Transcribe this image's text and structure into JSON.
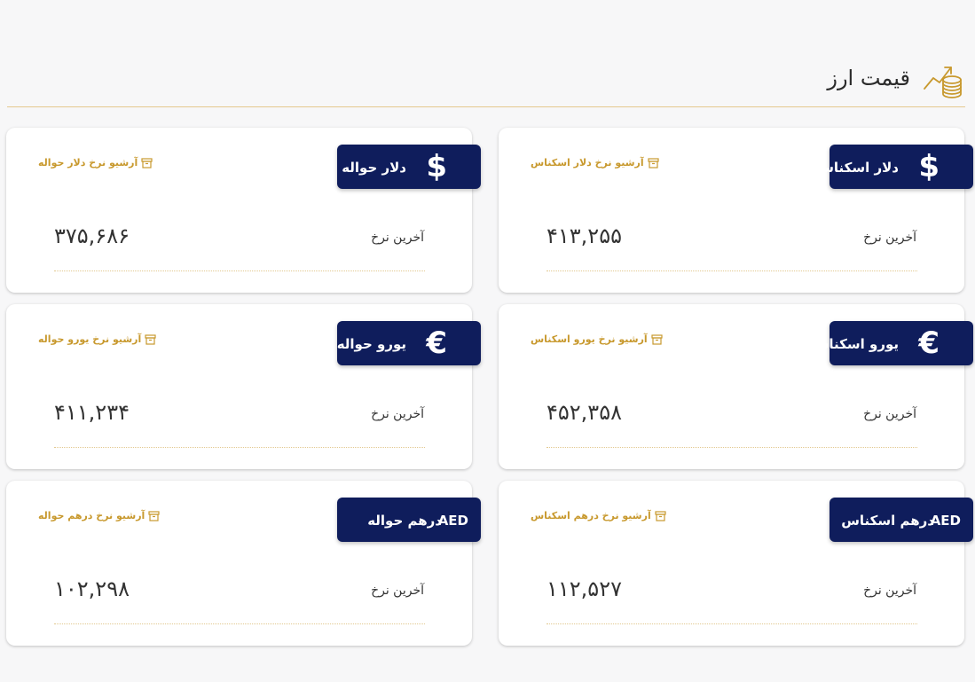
{
  "header": {
    "title": "قیمت ارز",
    "icon": "coins-chart-icon"
  },
  "colors": {
    "badge": "#0f1d5c",
    "gold": "#c8992e",
    "divider": "#e6c98f"
  },
  "cards": [
    {
      "currency": "دلار حواله",
      "symbol": "$",
      "archive_link": "آرشیو نرخ دلار حواله",
      "rate_label": "آخرین نرخ",
      "rate": "۳۷۵,۶۸۶"
    },
    {
      "currency": "دلار اسکناس",
      "symbol": "$",
      "archive_link": "آرشیو نرخ دلار اسکناس",
      "rate_label": "آخرین نرخ",
      "rate": "۴۱۳,۲۵۵"
    },
    {
      "currency": "یورو حواله",
      "symbol": "€",
      "archive_link": "آرشیو نرخ یورو حواله",
      "rate_label": "آخرین نرخ",
      "rate": "۴۱۱,۲۳۴"
    },
    {
      "currency": "یورو اسکناس",
      "symbol": "€",
      "archive_link": "آرشیو نرخ یورو اسکناس",
      "rate_label": "آخرین نرخ",
      "rate": "۴۵۲,۳۵۸"
    },
    {
      "currency": "درهم حواله",
      "symbol": "AED",
      "archive_link": "آرشیو نرخ درهم حواله",
      "rate_label": "آخرین نرخ",
      "rate": "۱۰۲,۲۹۸"
    },
    {
      "currency": "درهم اسکناس",
      "symbol": "AED",
      "archive_link": "آرشیو نرخ درهم اسکناس",
      "rate_label": "آخرین نرخ",
      "rate": "۱۱۲,۵۲۷"
    }
  ]
}
